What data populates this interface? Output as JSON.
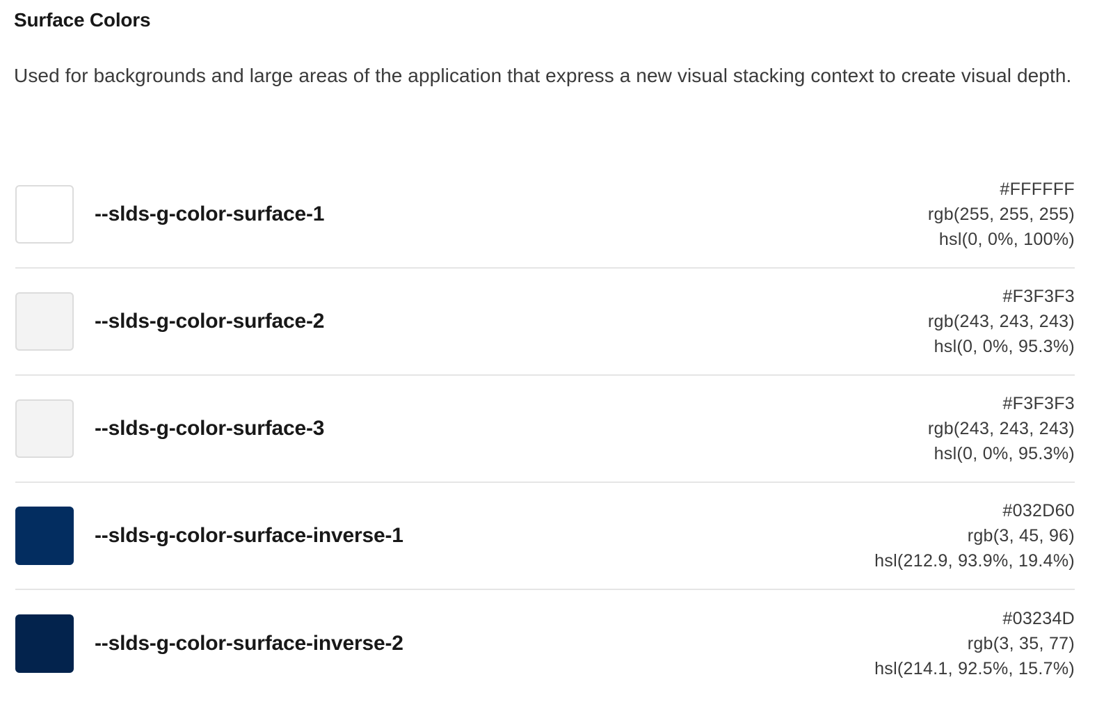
{
  "section": {
    "title": "Surface Colors",
    "description": "Used for backgrounds and large areas of the application that express a new visual stacking context to create visual depth."
  },
  "tokens": [
    {
      "name": "--slds-g-color-surface-1",
      "hex": "#FFFFFF",
      "rgb": "rgb(255, 255, 255)",
      "hsl": "hsl(0, 0%, 100%)",
      "swatch_color": "#FFFFFF"
    },
    {
      "name": "--slds-g-color-surface-2",
      "hex": "#F3F3F3",
      "rgb": "rgb(243, 243, 243)",
      "hsl": "hsl(0, 0%, 95.3%)",
      "swatch_color": "#F3F3F3"
    },
    {
      "name": "--slds-g-color-surface-3",
      "hex": "#F3F3F3",
      "rgb": "rgb(243, 243, 243)",
      "hsl": "hsl(0, 0%, 95.3%)",
      "swatch_color": "#F3F3F3"
    },
    {
      "name": "--slds-g-color-surface-inverse-1",
      "hex": "#032D60",
      "rgb": "rgb(3, 45, 96)",
      "hsl": "hsl(212.9, 93.9%, 19.4%)",
      "swatch_color": "#032D60"
    },
    {
      "name": "--slds-g-color-surface-inverse-2",
      "hex": "#03234D",
      "rgb": "rgb(3, 35, 77)",
      "hsl": "hsl(214.1, 92.5%, 15.7%)",
      "swatch_color": "#03234D"
    }
  ]
}
